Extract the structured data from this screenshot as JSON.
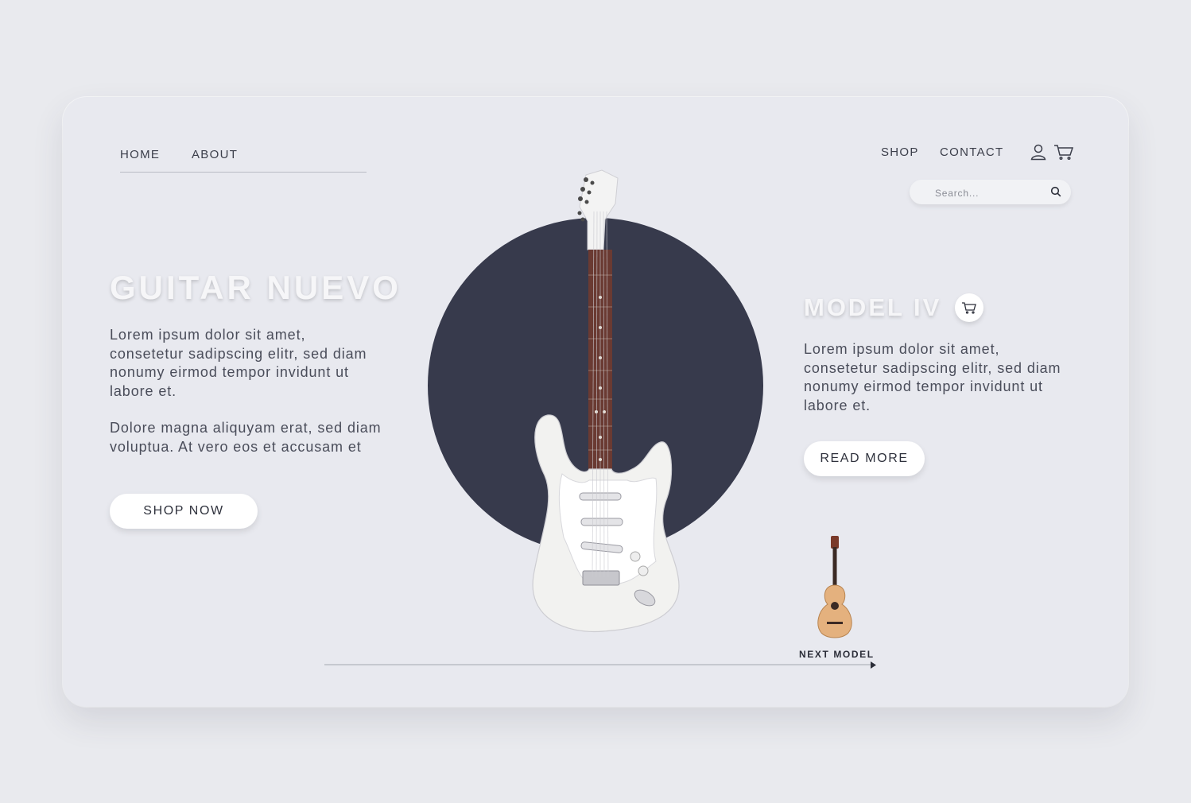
{
  "nav": {
    "home": "HOME",
    "about": "ABOUT",
    "shop": "SHOP",
    "contact": "CONTACT"
  },
  "icons": {
    "user": "user-icon",
    "cart": "cart-icon",
    "search": "search-icon"
  },
  "search": {
    "placeholder": "Search..."
  },
  "hero": {
    "title": "GUITAR NUEVO",
    "paragraph1": "Lorem ipsum dolor sit amet, consetetur sadipscing elitr, sed diam nonumy eirmod tempor invidunt ut labore et.",
    "paragraph2": "Dolore magna aliquyam erat, sed diam voluptua. At vero eos et accusam et",
    "cta": "SHOP NOW"
  },
  "model": {
    "title": "MODEL IV",
    "paragraph": "Lorem ipsum dolor sit amet, consetetur sadipscing elitr, sed diam nonumy eirmod tempor invidunt ut labore et.",
    "cta": "READ MORE"
  },
  "next": {
    "label": "NEXT MODEL"
  },
  "colors": {
    "background": "#e9eaee",
    "card": "#e8e9ef",
    "circle": "#373a4c",
    "text": "#3a3d4c",
    "button": "#ffffff"
  }
}
